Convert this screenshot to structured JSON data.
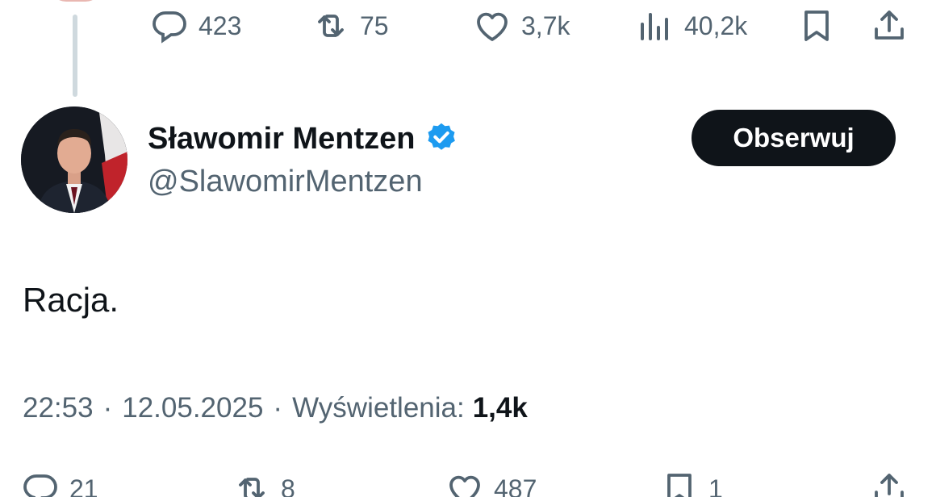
{
  "previous_tweet": {
    "actions": {
      "replies": "423",
      "retweets": "75",
      "likes": "3,7k",
      "views": "40,2k"
    }
  },
  "tweet": {
    "author": {
      "name": "Sławomir Mentzen",
      "handle": "@SlawomirMentzen",
      "verified": true
    },
    "follow_label": "Obserwuj",
    "text": "Racja.",
    "time": "22:53",
    "date": "12.05.2025",
    "views_label": "Wyświetlenia:",
    "views_count": "1,4k",
    "actions": {
      "replies": "21",
      "retweets": "8",
      "likes": "487",
      "bookmarks": "1"
    }
  },
  "colors": {
    "text_primary": "#0f1419",
    "text_secondary": "#536471",
    "verified_blue": "#1d9bf0",
    "button_bg": "#0f1419"
  }
}
